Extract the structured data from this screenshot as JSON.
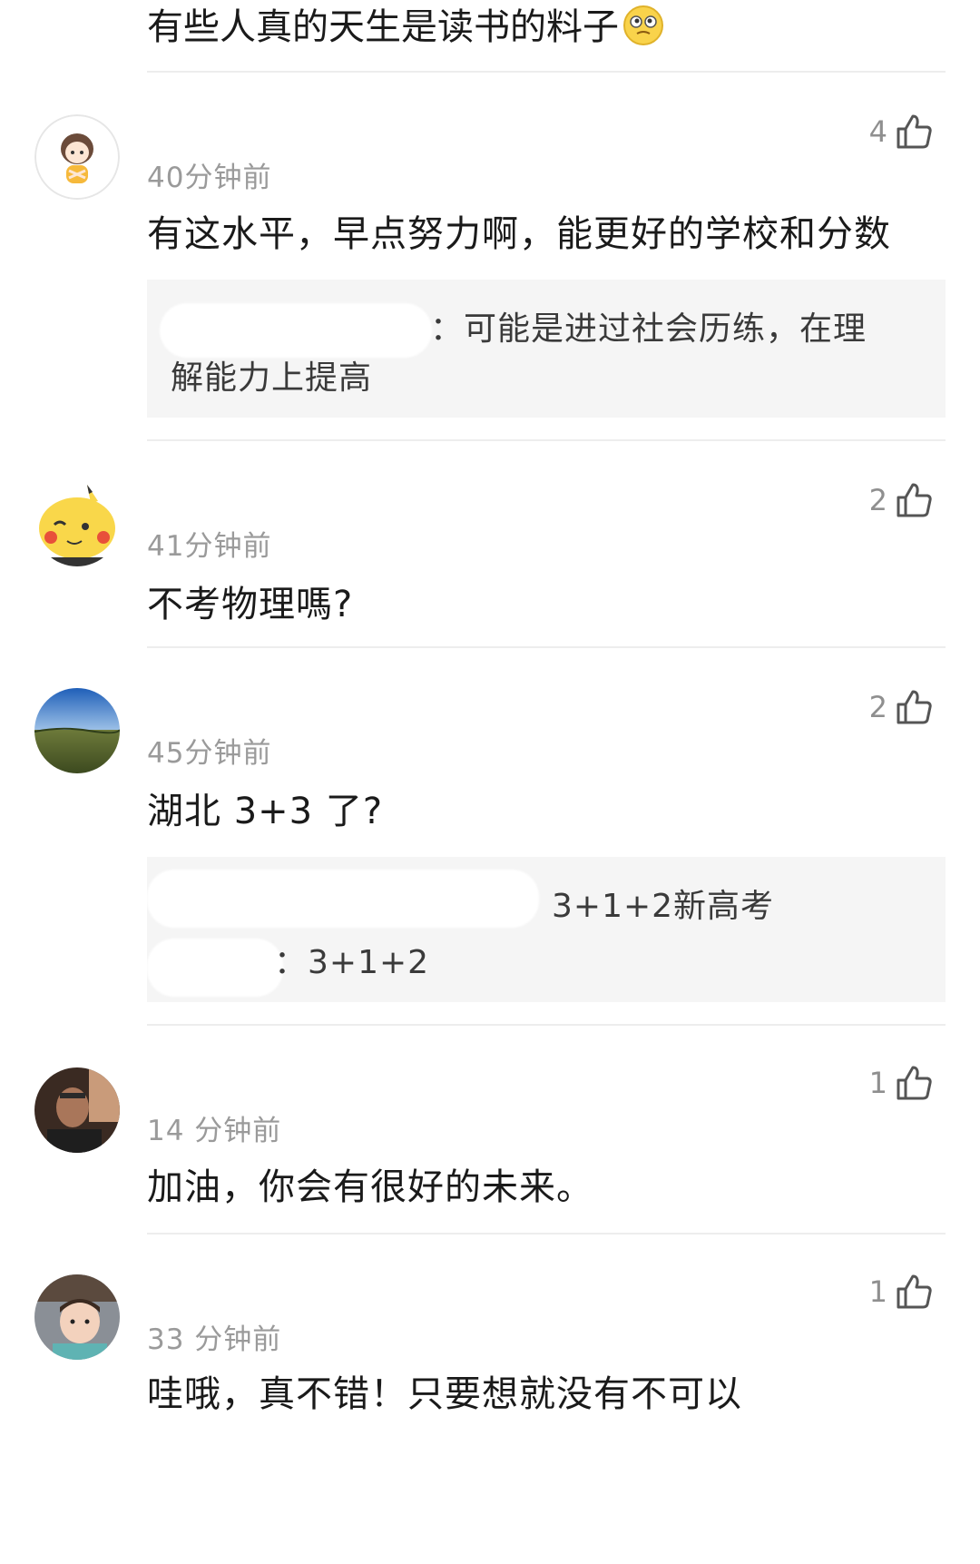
{
  "top_comment": {
    "text": "有些人真的天生是读书的料子",
    "emoji": "thinking-face-icon"
  },
  "comments": [
    {
      "avatar": "cartoon-girl-avatar",
      "time": "40分钟前",
      "likes": "4",
      "text": "有这水平，早点努力啊，能更好的学校和分数",
      "reply": {
        "line1": "：可能是进过社会历练，在理",
        "line2": "解能力上提高"
      }
    },
    {
      "avatar": "pikachu-avatar",
      "time": "41分钟前",
      "likes": "2",
      "text": "不考物理嗎?"
    },
    {
      "avatar": "landscape-avatar",
      "time": "45分钟前",
      "likes": "2",
      "text": "湖北 3+3 了?",
      "reply": {
        "line1": "3+1+2新高考",
        "line2": "：3+1+2"
      }
    },
    {
      "avatar": "man-photo-avatar",
      "time": "14 分钟前",
      "likes": "1",
      "text": "加油，你会有很好的未来。"
    },
    {
      "avatar": "child-photo-avatar",
      "time": "33 分钟前",
      "likes": "1",
      "text": "哇哦，真不错！只要想就没有不可以"
    }
  ],
  "colors": {
    "text": "#1a1a1a",
    "meta": "#9a9a9a",
    "reply_bg": "#f5f5f5",
    "divider": "#ededed"
  }
}
